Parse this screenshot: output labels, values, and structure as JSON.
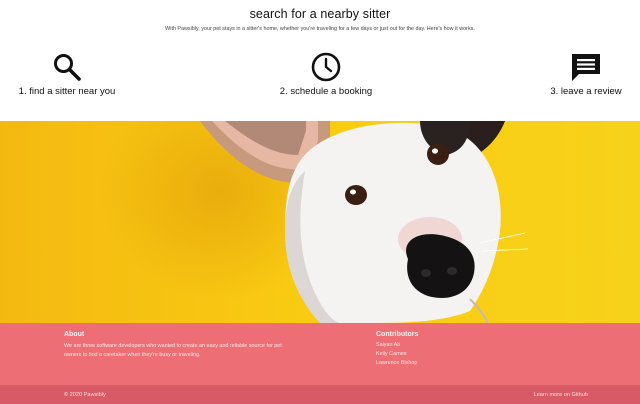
{
  "intro": {
    "title": "search for a nearby sitter",
    "subtitle": "With Pawsibly, your pet stays in a sitter's home, whether you're traveling for a few days or just out for the day. Here's how it works."
  },
  "steps": [
    {
      "label": "1. find a sitter near you",
      "icon": "search-icon"
    },
    {
      "label": "2. schedule a booking",
      "icon": "clock-icon"
    },
    {
      "label": "3. leave a review",
      "icon": "chat-icon"
    }
  ],
  "hero": {
    "image": "white-dog-on-yellow-photo"
  },
  "footer": {
    "about": {
      "heading": "About",
      "text": "We are three software developers who wanted to create an easy and reliable source for pet owners to find a caretaker when they're busy or traveling."
    },
    "contributors": {
      "heading": "Contributors",
      "names": [
        "Saiyan Ali",
        "Kelly Carnes",
        "Lawrence Bishop"
      ]
    }
  },
  "bottom": {
    "copyright": "© 2020 Pawsibly",
    "learn_more": "Learn more on Github"
  },
  "colors": {
    "hero_bg": "#f7c70f",
    "footer_bg": "#ed6e74",
    "bottom_bg": "#d85a66"
  }
}
